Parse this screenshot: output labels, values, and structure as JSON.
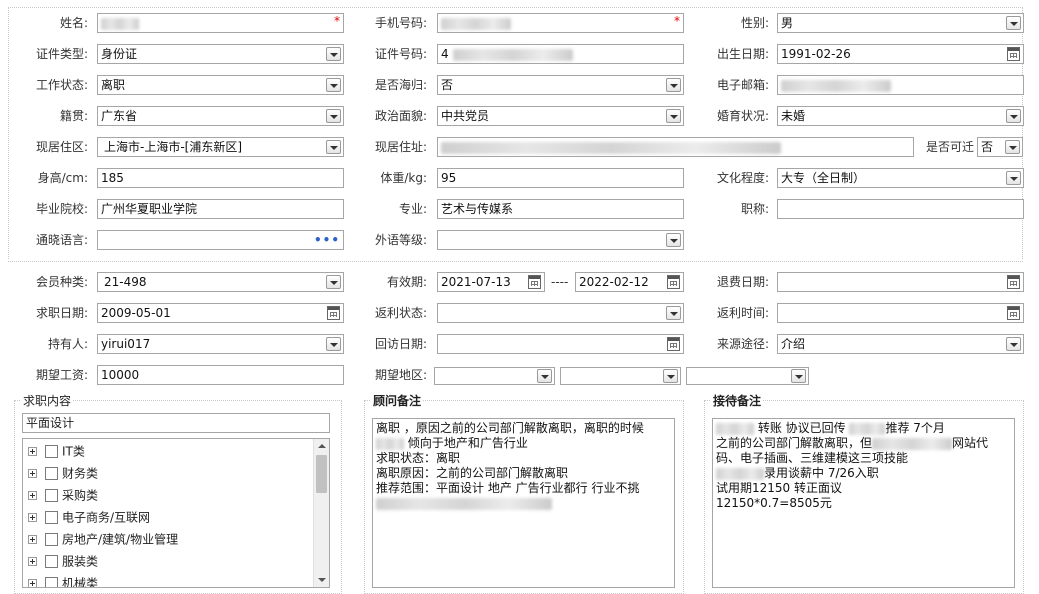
{
  "basic": {
    "name": {
      "label": "姓名:",
      "required": "*"
    },
    "phone": {
      "label": "手机号码:",
      "required": "*"
    },
    "gender": {
      "label": "性别:",
      "value": "男"
    },
    "id_type": {
      "label": "证件类型:",
      "value": "身份证"
    },
    "id_no": {
      "label": "证件号码:",
      "value": "4"
    },
    "birthday": {
      "label": "出生日期:",
      "value": "1991-02-26"
    },
    "work_status": {
      "label": "工作状态:",
      "value": "离职"
    },
    "returnee": {
      "label": "是否海归:",
      "value": "否"
    },
    "email": {
      "label": "电子邮箱:"
    },
    "native": {
      "label": "籍贯:",
      "value": "广东省"
    },
    "political": {
      "label": "政治面貌:",
      "value": "中共党员"
    },
    "marital": {
      "label": "婚育状况:",
      "value": "未婚"
    },
    "residence_area": {
      "label": "现居住区:",
      "value": "上海市-上海市-[浦东新区]"
    },
    "residence_addr": {
      "label": "现居住址:"
    },
    "relocate": {
      "label": "是否可迁",
      "value": "否"
    },
    "height": {
      "label": "身高/cm:",
      "value": "185"
    },
    "weight": {
      "label": "体重/kg:",
      "value": "95"
    },
    "education": {
      "label": "文化程度:",
      "value": "大专（全日制）"
    },
    "school": {
      "label": "毕业院校:",
      "value": "广州华夏职业学院"
    },
    "major": {
      "label": "专业:",
      "value": "艺术与传媒系"
    },
    "title": {
      "label": "职称:",
      "value": ""
    },
    "language": {
      "label": "通晓语言:",
      "value": "",
      "picker": "•••"
    },
    "foreign_level": {
      "label": "外语等级:",
      "value": ""
    }
  },
  "membership": {
    "member_type": {
      "label": "会员种类:",
      "value": "21-498"
    },
    "valid_period": {
      "label": "有效期:",
      "from": "2021-07-13",
      "separator": "----",
      "to": "2022-02-12"
    },
    "refund_date": {
      "label": "退费日期:",
      "value": ""
    },
    "job_date": {
      "label": "求职日期:",
      "value": "2009-05-01"
    },
    "rebate_status": {
      "label": "返利状态:",
      "value": ""
    },
    "rebate_time": {
      "label": "返利时间:",
      "value": ""
    },
    "holder": {
      "label": "持有人:",
      "value": "yirui017"
    },
    "visit_date": {
      "label": "回访日期:",
      "value": ""
    },
    "source": {
      "label": "来源途径:",
      "value": "介绍"
    },
    "salary": {
      "label": "期望工资:",
      "value": "10000"
    },
    "region": {
      "label": "期望地区:",
      "values": [
        "",
        "",
        ""
      ]
    }
  },
  "job_content": {
    "legend": "求职内容",
    "search_value": "平面设计",
    "items": [
      "IT类",
      "财务类",
      "采购类",
      "电子商务/互联网",
      "房地产/建筑/物业管理",
      "服装类",
      "机械类"
    ]
  },
  "advisor_notes": {
    "legend": "顾问备注",
    "lines": [
      {
        "pre": "离职 ，原因之前的公司部门解散离职，离职的时候",
        "post": ""
      },
      {
        "pre": "",
        "post": " 倾向于地产和广告行业"
      },
      {
        "pre": "求职状态：离职",
        "post": ""
      },
      {
        "pre": "离职原因：之前的公司部门解散离职",
        "post": ""
      },
      {
        "pre": "推荐范围：平面设计  地产 广告行业都行 行业不挑",
        "post": ""
      },
      {
        "pre": "",
        "post": ""
      }
    ]
  },
  "reception_notes": {
    "legend": "接待备注",
    "lines": [
      {
        "pre": "",
        "mid": " 转账  协议已回传 ",
        "post": "推荐 7个月"
      },
      {
        "pre": "之前的公司部门解散离职，但",
        "mid": "",
        "post": "网站代"
      },
      {
        "pre": "码、电子插画、三维建模这三项技能",
        "mid": "",
        "post": ""
      },
      {
        "pre": "",
        "mid": "录用谈薪中  7/26入职",
        "post": ""
      },
      {
        "pre": "试用期12150 转正面议",
        "mid": "",
        "post": ""
      },
      {
        "pre": "12150*0.7=8505元",
        "mid": "",
        "post": ""
      }
    ]
  }
}
